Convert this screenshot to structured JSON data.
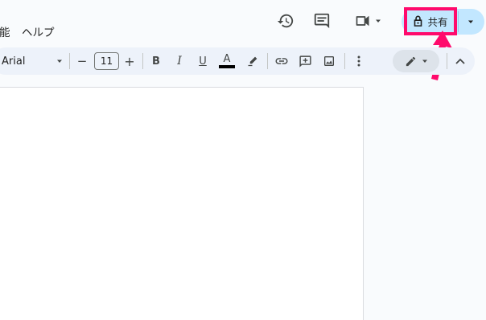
{
  "menu": {
    "partial_item": "能",
    "help": "ヘルプ"
  },
  "header_icons": [
    "history-icon",
    "comment-icon",
    "meet-icon",
    "lock-icon"
  ],
  "share": {
    "label": "共有"
  },
  "toolbar": {
    "font_name": "Arial",
    "font_size": "11",
    "decrease_symbol": "−",
    "increase_symbol": "+",
    "bold": "B",
    "italic": "I",
    "underline": "U",
    "text_color_letter": "A"
  },
  "colors": {
    "accent_highlight": "#ff0a6c",
    "share_bg": "#c2e7ff",
    "toolbar_bg": "#edf2fa"
  }
}
